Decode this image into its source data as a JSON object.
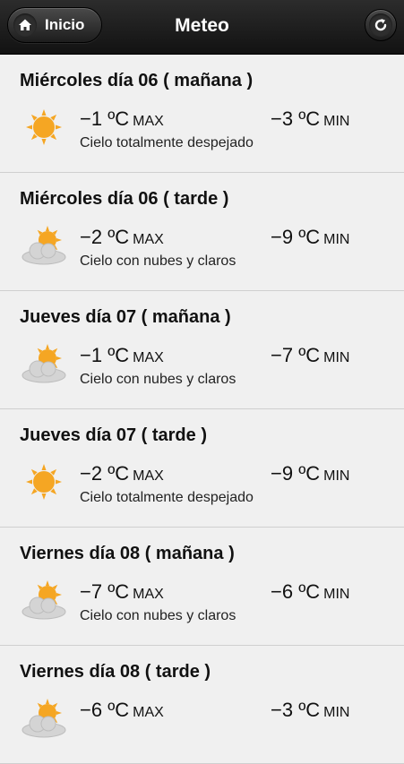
{
  "header": {
    "back_label": "Inicio",
    "title": "Meteo"
  },
  "forecasts": [
    {
      "title": "Miércoles día 06 ( mañana )",
      "icon": "sun-icon",
      "max": "−1 ºC",
      "max_label": "MAX",
      "min": "−3 ºC",
      "min_label": "MIN",
      "description": "Cielo totalmente despejado"
    },
    {
      "title": "Miércoles día 06 ( tarde )",
      "icon": "sun-cloud-icon",
      "max": "−2 ºC",
      "max_label": "MAX",
      "min": "−9 ºC",
      "min_label": "MIN",
      "description": "Cielo con nubes y claros"
    },
    {
      "title": "Jueves día 07 ( mañana )",
      "icon": "sun-cloud-icon",
      "max": "−1 ºC",
      "max_label": "MAX",
      "min": "−7 ºC",
      "min_label": "MIN",
      "description": "Cielo con nubes y claros"
    },
    {
      "title": "Jueves día 07 ( tarde )",
      "icon": "sun-icon",
      "max": "−2 ºC",
      "max_label": "MAX",
      "min": "−9 ºC",
      "min_label": "MIN",
      "description": "Cielo totalmente despejado"
    },
    {
      "title": "Viernes día 08 ( mañana )",
      "icon": "sun-cloud-icon",
      "max": "−7 ºC",
      "max_label": "MAX",
      "min": "−6 ºC",
      "min_label": "MIN",
      "description": "Cielo con nubes y claros"
    },
    {
      "title": "Viernes día 08 ( tarde )",
      "icon": "sun-cloud-icon",
      "max": "−6 ºC",
      "max_label": "MAX",
      "min": "−3 ºC",
      "min_label": "MIN",
      "description": ""
    }
  ],
  "colors": {
    "sun": "#f5a623",
    "cloud": "#d4d4d4",
    "header_bg": "#1a1a1a"
  }
}
